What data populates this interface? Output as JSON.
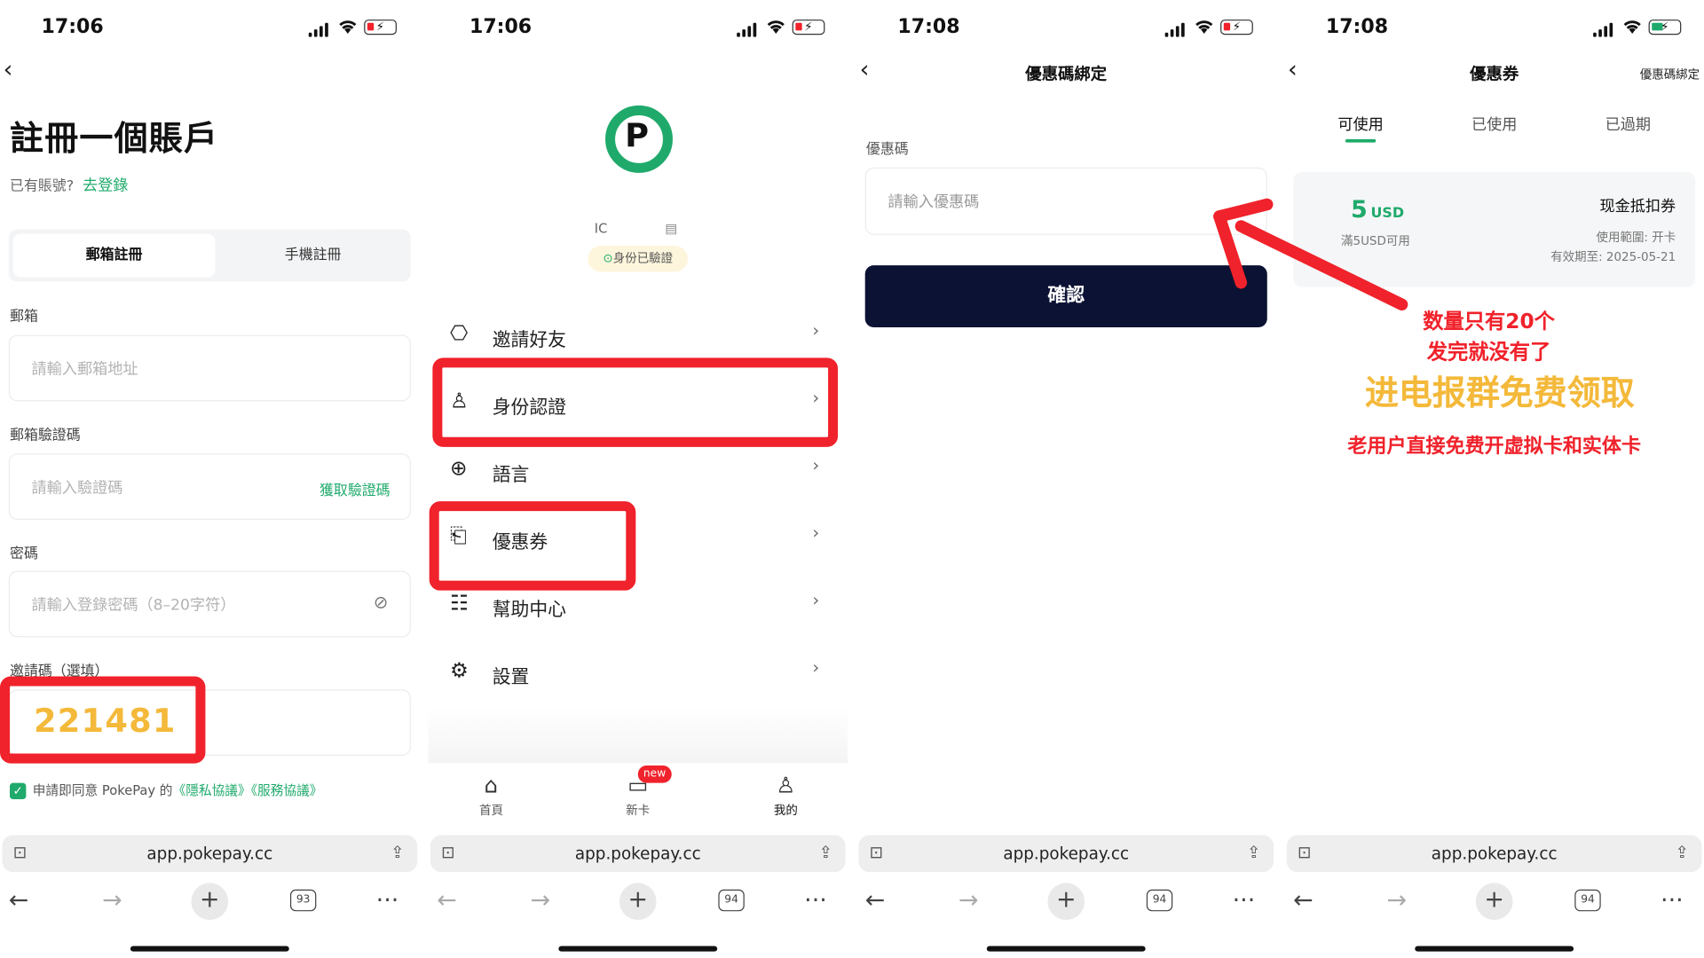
{
  "status_bars": [
    {
      "time": "17:06"
    },
    {
      "time": "17:06"
    },
    {
      "time": "17:08"
    },
    {
      "time": "17:08"
    }
  ],
  "register": {
    "title": "註冊一個賬戶",
    "has_account": "已有賬號?",
    "login_link": "去登錄",
    "tabs": [
      "郵箱註冊",
      "手機註冊"
    ],
    "email_label": "郵箱",
    "email_placeholder": "請輸入郵箱地址",
    "code_label": "郵箱驗證碼",
    "code_placeholder": "請輸入驗證碼",
    "get_code": "獲取驗證碼",
    "password_label": "密碼",
    "password_placeholder": "請輸入登錄密碼（8–20字符）",
    "invite_label": "邀請碼（選填）",
    "invite_value": "221481",
    "agree_prefix": "申請即同意 PokePay 的",
    "privacy": "《隱私協議》",
    "service": "《服務協議》"
  },
  "profile": {
    "logo_letter": "P",
    "id_text": "IC",
    "verified": "身份已驗證",
    "menu": [
      "邀請好友",
      "身份認證",
      "語言",
      "優惠券",
      "幫助中心",
      "設置"
    ],
    "tabbar": [
      "首頁",
      "新卡",
      "我的"
    ],
    "new_badge": "new"
  },
  "bind_code": {
    "title": "優惠碼綁定",
    "label": "優惠碼",
    "placeholder": "請輸入優惠碼",
    "confirm": "確認"
  },
  "coupons": {
    "title": "優惠券",
    "right_link": "優惠碼綁定",
    "tabs": [
      "可使用",
      "已使用",
      "已過期"
    ],
    "amount": "5",
    "unit": "USD",
    "condition": "滿5USD可用",
    "name": "现金抵扣券",
    "scope": "使用範圍: 开卡",
    "expiry": "有效期至: 2025-05-21"
  },
  "browser": {
    "url": "app.pokepay.cc",
    "tab_counts": [
      "93",
      "94",
      "94",
      "94"
    ]
  },
  "annotation": {
    "line1": "数量只有20个",
    "line2": "发完就没有了",
    "line3": "进电报群免费领取",
    "line4": "老用户直接免费开虚拟卡和实体卡",
    "colors": {
      "red": "#f0222b",
      "gold": "#f4b93a",
      "green": "#1faa6b",
      "navy": "#0b1233"
    }
  }
}
